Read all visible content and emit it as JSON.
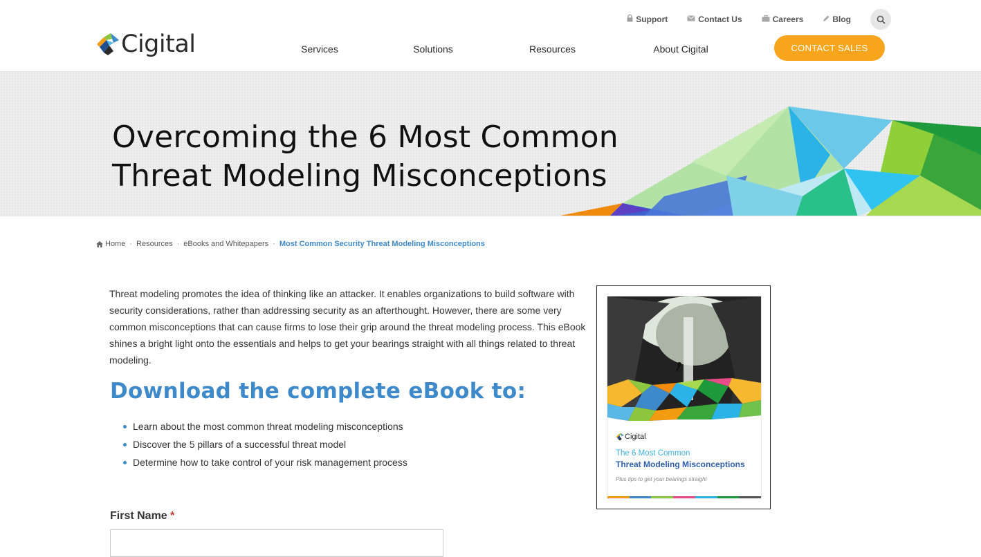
{
  "brand": {
    "logo_text": "Cigital"
  },
  "utility_nav": [
    {
      "label": "Support",
      "icon": "lock-icon"
    },
    {
      "label": "Contact Us",
      "icon": "envelope-icon"
    },
    {
      "label": "Careers",
      "icon": "briefcase-icon"
    },
    {
      "label": "Blog",
      "icon": "pencil-icon"
    }
  ],
  "main_nav": [
    {
      "label": "Services",
      "active": false
    },
    {
      "label": "Solutions",
      "active": false
    },
    {
      "label": "Resources",
      "active": true
    },
    {
      "label": "About Cigital",
      "active": false
    }
  ],
  "contact_sales_label": "CONTACT SALES",
  "hero": {
    "title_line1": "Overcoming the 6 Most Common",
    "title_line2": "Threat Modeling Misconceptions"
  },
  "breadcrumb": [
    {
      "label": "Home",
      "icon": "home-icon"
    },
    {
      "label": "Resources"
    },
    {
      "label": "eBooks and Whitepapers"
    },
    {
      "label": "Most Common Security Threat Modeling Misconceptions",
      "current": true
    }
  ],
  "content": {
    "intro": "Threat modeling promotes the idea of thinking like an attacker. It enables organizations to build software with security considerations, rather than addressing security as an afterthought. However, there are some very common misconceptions that can cause firms to lose their grip around the threat modeling process. This eBook shines a bright light onto the essentials and helps to get your bearings straight with all things related to threat modeling.",
    "download_heading": "Download the complete eBook to:",
    "bullets": [
      "Learn about the most common threat modeling misconceptions",
      "Discover the 5 pillars of a successful threat model",
      "Determine how to take control of your risk management process"
    ]
  },
  "form": {
    "first_name_label": "First Name",
    "required_mark": "*",
    "first_name_value": "",
    "first_name_placeholder": ""
  },
  "ebook_cover": {
    "logo_text": "Cigital",
    "title_line1": "The 6 Most Common",
    "title_line2": "Threat Modeling Misconceptions",
    "subtitle": "Plus tips to get your bearings straight"
  },
  "colors": {
    "accent_blue": "#3e89c9",
    "cta_orange": "#f7a51d",
    "required_red": "#c0392b"
  }
}
